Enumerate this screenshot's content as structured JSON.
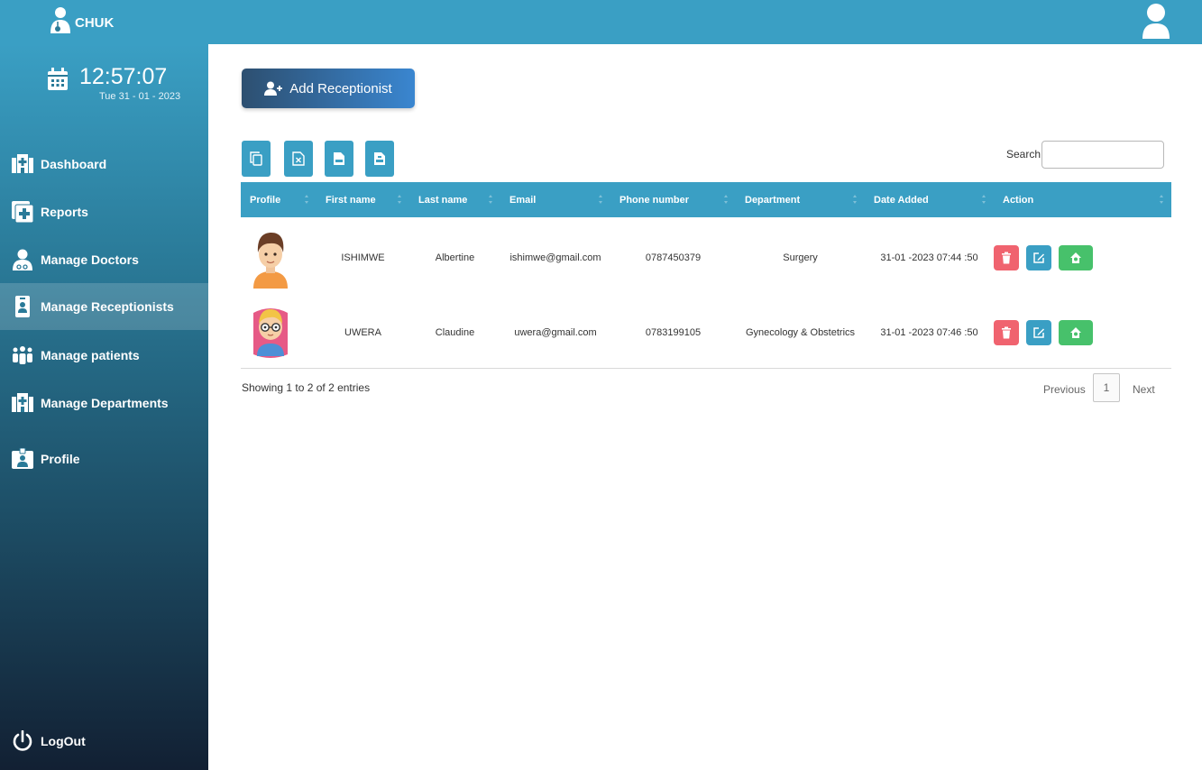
{
  "app": {
    "name": "CHUK"
  },
  "clock": {
    "time": "12:57:07",
    "date": "Tue 31 - 01 - 2023"
  },
  "sidebar": {
    "items": [
      {
        "label": "Dashboard",
        "icon": "hospital-icon",
        "active": false
      },
      {
        "label": "Reports",
        "icon": "medical-file-icon",
        "active": false
      },
      {
        "label": "Manage Doctors",
        "icon": "doctor-icon",
        "active": false
      },
      {
        "label": "Manage Receptionists",
        "icon": "id-badge-icon",
        "active": true
      },
      {
        "label": "Manage patients",
        "icon": "people-group-icon",
        "active": false
      },
      {
        "label": "Manage Departments",
        "icon": "hospital-icon",
        "active": false
      },
      {
        "label": "Profile",
        "icon": "id-card-icon",
        "active": false
      }
    ],
    "logout_label": "LogOut"
  },
  "main": {
    "add_button_label": "Add Receptionist",
    "export_buttons": [
      "copy-icon",
      "excel-icon",
      "csv-icon",
      "pdf-icon"
    ],
    "search_label": "Search:",
    "search_value": "",
    "columns": [
      "Profile",
      "First name",
      "Last name",
      "Email",
      "Phone number",
      "Department",
      "Date Added",
      "Action"
    ],
    "rows": [
      {
        "avatar": "boy-avatar-icon",
        "first_name": "ISHIMWE",
        "last_name": "Albertine",
        "email": "ishimwe@gmail.com",
        "phone": "0787450379",
        "department": "Surgery",
        "date_added": "31-01 -2023 07:44 :50"
      },
      {
        "avatar": "girl-glasses-avatar-icon",
        "first_name": "UWERA",
        "last_name": "Claudine",
        "email": "uwera@gmail.com",
        "phone": "0783199105",
        "department": "Gynecology & Obstetrics",
        "date_added": "31-01 -2023 07:46 :50"
      }
    ],
    "info": "Showing 1 to 2 of 2 entries",
    "pagination": {
      "previous": "Previous",
      "current": "1",
      "next": "Next"
    }
  },
  "colors": {
    "topbar": "#3a9fc4",
    "delete": "#f0636f",
    "edit": "#3a9fc4",
    "view": "#47c16b"
  }
}
